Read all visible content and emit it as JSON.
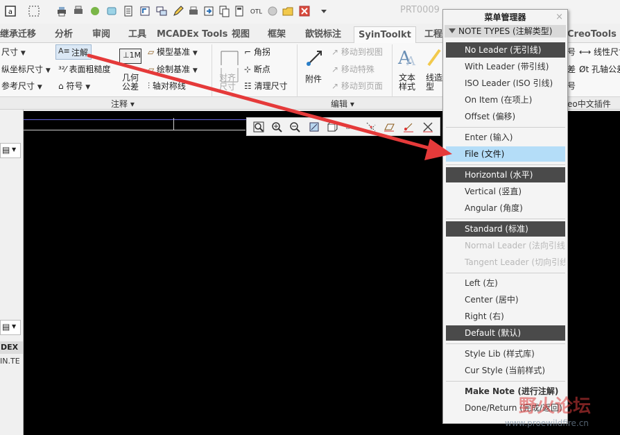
{
  "window": {
    "title": "PRT0009"
  },
  "ribbon_tabs": [
    {
      "label": "继承迁移"
    },
    {
      "label": "分析"
    },
    {
      "label": "审阅"
    },
    {
      "label": "工具"
    },
    {
      "label": "MCADEx Tools"
    },
    {
      "label": "视图"
    },
    {
      "label": "框架"
    },
    {
      "label": "歆锐标注"
    },
    {
      "label": "SyinToolkt"
    },
    {
      "label": "工程"
    },
    {
      "label": "CreoTools"
    }
  ],
  "ribbon": {
    "dims": [
      "尺寸",
      "纵坐标尺寸",
      "参考尺寸"
    ],
    "note": "注解",
    "surface_finish": "表面粗糙度",
    "symbol": "符号",
    "geometric_tolerance": "几何\n公差",
    "model_datum": "模型基准",
    "draw_datum": "绘制基准",
    "axis_lines": "轴对称线",
    "corner": "角拐",
    "breakpoint": "断点",
    "clean_dims": "清理尺寸",
    "align_dims": "对齐\n尺寸",
    "attach": "附件",
    "move_to_view": "移动到视图",
    "move_special": "移动特殊",
    "move_to_page": "移动到页面",
    "text_style": "文本\n样式",
    "line_style": "线造\n型",
    "right_items": [
      "线性尺寸",
      "孔轴公差",
      "号"
    ],
    "right_plugin": "eo中文插件",
    "group_labels": [
      "注释",
      "编辑"
    ]
  },
  "left_panel": {
    "labels": [
      "DEX",
      "IN.TE"
    ]
  },
  "menu_manager": {
    "title": "菜单管理器",
    "header": "NOTE TYPES (注解类型)",
    "close": "×",
    "items": [
      {
        "label": "No Leader (无引线)",
        "state": "selected"
      },
      {
        "label": "With Leader (带引线)",
        "state": "normal"
      },
      {
        "label": "ISO Leader (ISO 引线)",
        "state": "normal"
      },
      {
        "label": "On Item (在项上)",
        "state": "normal"
      },
      {
        "label": "Offset (偏移)",
        "state": "normal"
      },
      {
        "label": "Enter (输入)",
        "state": "normal"
      },
      {
        "label": "File (文件)",
        "state": "highlighted"
      },
      {
        "label": "Horizontal (水平)",
        "state": "selected"
      },
      {
        "label": "Vertical (竖直)",
        "state": "normal"
      },
      {
        "label": "Angular (角度)",
        "state": "normal"
      },
      {
        "label": "Standard (标准)",
        "state": "selected"
      },
      {
        "label": "Normal Leader (法向引线)",
        "state": "disabled"
      },
      {
        "label": "Tangent Leader (切向引线)",
        "state": "disabled"
      },
      {
        "label": "Left (左)",
        "state": "normal"
      },
      {
        "label": "Center (居中)",
        "state": "normal"
      },
      {
        "label": "Right (右)",
        "state": "normal"
      },
      {
        "label": "Default (默认)",
        "state": "selected"
      },
      {
        "label": "Style Lib (样式库)",
        "state": "normal"
      },
      {
        "label": "Cur Style (当前样式)",
        "state": "normal"
      },
      {
        "label": "Make Note (进行注解)",
        "state": "normal"
      },
      {
        "label": "Done/Return (完成/返回)",
        "state": "normal"
      }
    ]
  },
  "watermark": {
    "text": "野火论坛",
    "url": "www.proewildfire.cn"
  },
  "colors": {
    "selected": "#4a4a4a",
    "highlight": "#b4ddf8",
    "arrow": "#e53a3a",
    "canvas": "#000000"
  }
}
